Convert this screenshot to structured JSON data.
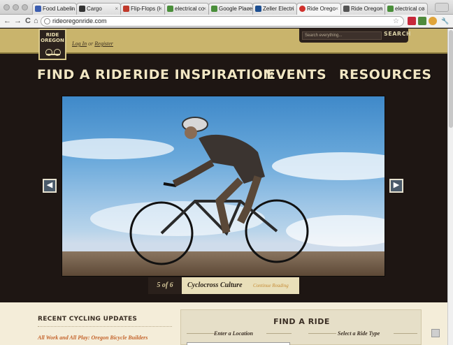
{
  "browser": {
    "tabs": [
      {
        "label": "Food Labelin",
        "fav": "#3b5db0"
      },
      {
        "label": "Cargo",
        "fav": "#333333"
      },
      {
        "label": "Flip-Flops (I",
        "fav": "#c0392b"
      },
      {
        "label": "electrical co",
        "fav": "#4a8f3a"
      },
      {
        "label": "Google Place",
        "fav": "#4a8f3a"
      },
      {
        "label": "Zeller Electri",
        "fav": "#1d4f91"
      },
      {
        "label": "Ride Orego",
        "fav": "#d0312d"
      },
      {
        "label": "Ride Oregon",
        "fav": "#555555"
      },
      {
        "label": "electrical co",
        "fav": "#4a8f3a"
      }
    ],
    "back_icon": "←",
    "forward_icon": "→",
    "reload_icon": "C",
    "home_icon": "⌂",
    "url": "rideoregonride.com",
    "star_icon": "☆",
    "wrench_icon": "🔧"
  },
  "site": {
    "logo_line1": "RIDE",
    "logo_line2": "OREGON",
    "login": "Log In",
    "or": "or",
    "register": "Register",
    "search_placeholder": "Search everything...",
    "search_button": "SEARCH",
    "nav": [
      "FIND A RIDE",
      "RIDE INSPIRATION",
      "EVENTS",
      "RESOURCES"
    ]
  },
  "slideshow": {
    "prev_icon": "◀",
    "next_icon": "▶",
    "count": "5 of 6",
    "title": "Cyclocross Culture",
    "link": "Continue Reading"
  },
  "updates": {
    "title": "RECENT CYCLING UPDATES",
    "item": "All Work and All Play: Oregon Bicycle Builders"
  },
  "find": {
    "title": "FIND A RIDE",
    "location_label": "Enter a Location",
    "type_label": "Select a Ride Type"
  },
  "colors": {
    "header": "#c9b46c",
    "dark_bg": "#1e1613",
    "nav_text": "#f1e6c3",
    "accent": "#c4632a"
  }
}
